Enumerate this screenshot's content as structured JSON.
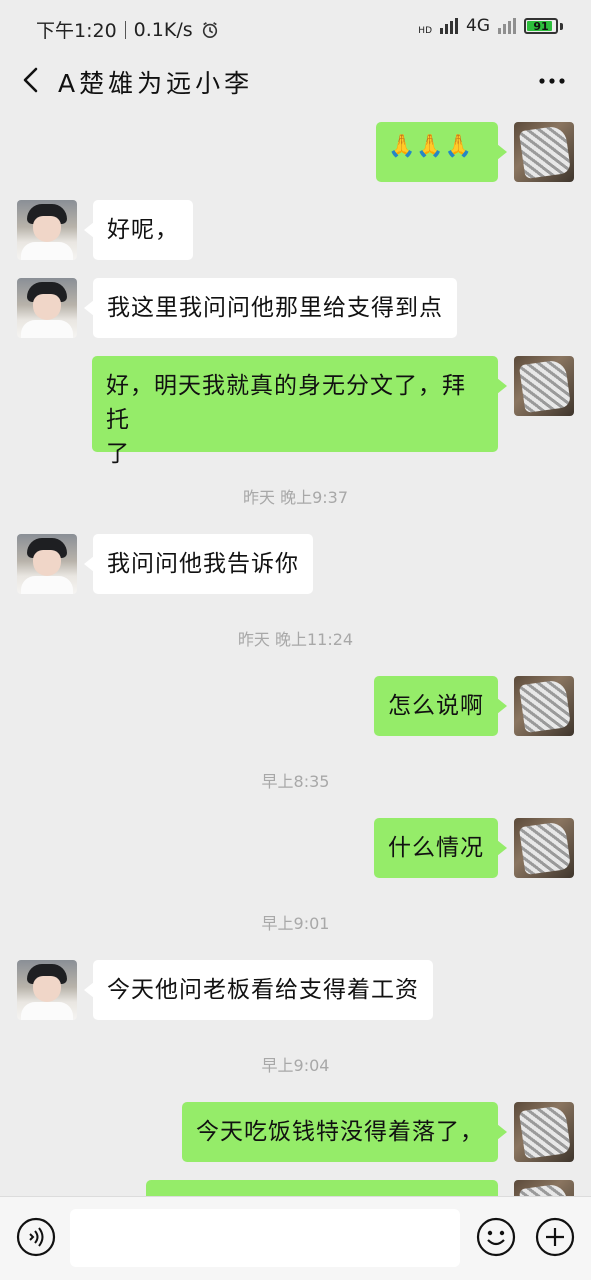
{
  "status_bar": {
    "time": "下午1:20",
    "speed": "0.1K/s",
    "hd": "HD",
    "network": "4G",
    "battery": "91",
    "battery_level": 0.91,
    "battery_color": "#2dbe3c"
  },
  "header": {
    "title": "A楚雄为远小李",
    "back_icon": "chevron-left-icon",
    "more_icon": "more-dots-icon"
  },
  "colors": {
    "background": "#ededed",
    "bubble_me": "#95ec69",
    "bubble_them": "#ffffff"
  },
  "messages": [
    {
      "sender": "me",
      "type": "emoji",
      "content": "🙏🙏🙏"
    },
    {
      "sender": "them",
      "type": "text",
      "content": "好呢，"
    },
    {
      "sender": "them",
      "type": "text",
      "content": "我这里我问问他那里给支得到点"
    },
    {
      "sender": "me",
      "type": "text",
      "line1": "好，明天我就真的身无分文了，拜托",
      "line2": "了"
    },
    {
      "type": "timestamp",
      "content": "昨天 晚上9:37"
    },
    {
      "sender": "them",
      "type": "text",
      "content": "我问问他我告诉你"
    },
    {
      "type": "timestamp",
      "content": "昨天 晚上11:24"
    },
    {
      "sender": "me",
      "type": "text",
      "content": "怎么说啊"
    },
    {
      "type": "timestamp",
      "content": "早上8:35"
    },
    {
      "sender": "me",
      "type": "text",
      "content": "什么情况"
    },
    {
      "type": "timestamp",
      "content": "早上9:01"
    },
    {
      "sender": "them",
      "type": "text",
      "content": "今天他问老板看给支得着工资"
    },
    {
      "type": "timestamp",
      "content": "早上9:04"
    },
    {
      "sender": "me",
      "type": "text",
      "content": "今天吃饭钱特没得着落了，"
    },
    {
      "sender": "me",
      "type": "text",
      "content": ""
    }
  ],
  "input_bar": {
    "value": "",
    "voice_icon": "voice-icon",
    "emoji_icon": "smiley-icon",
    "plus_icon": "plus-icon"
  }
}
